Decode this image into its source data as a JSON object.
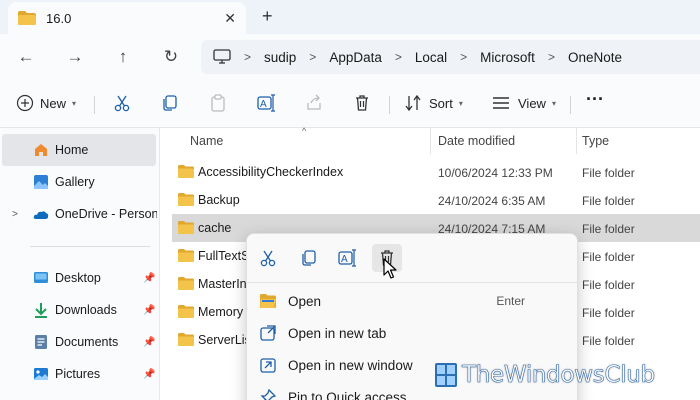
{
  "tab": {
    "title": "16.0",
    "close_glyph": "✕",
    "new_glyph": "+"
  },
  "nav": {
    "back": "←",
    "forward": "→",
    "up": "↑",
    "refresh": "↻"
  },
  "breadcrumb": [
    "sudip",
    "AppData",
    "Local",
    "Microsoft",
    "OneNote"
  ],
  "toolbar": {
    "new_label": "New",
    "sort_label": "Sort",
    "view_label": "View",
    "more_glyph": "···"
  },
  "sidebar": {
    "items": [
      {
        "label": "Home",
        "icon": "home-icon",
        "selected": true
      },
      {
        "label": "Gallery",
        "icon": "gallery-icon"
      },
      {
        "label": "OneDrive - Personal",
        "icon": "onedrive-icon",
        "expandable": true
      },
      {
        "label": "Desktop",
        "icon": "desktop-icon",
        "pinned": true
      },
      {
        "label": "Downloads",
        "icon": "downloads-icon",
        "pinned": true
      },
      {
        "label": "Documents",
        "icon": "documents-icon",
        "pinned": true
      },
      {
        "label": "Pictures",
        "icon": "pictures-icon",
        "pinned": true
      }
    ]
  },
  "columns": {
    "name": "Name",
    "date": "Date modified",
    "type": "Type"
  },
  "files": [
    {
      "name": "AccessibilityCheckerIndex",
      "date": "10/06/2024 12:33 PM",
      "type": "File folder"
    },
    {
      "name": "Backup",
      "date": "24/10/2024 6:35 AM",
      "type": "File folder"
    },
    {
      "name": "cache",
      "date": "24/10/2024 7:15 AM",
      "type": "File folder",
      "selected": true
    },
    {
      "name": "FullTextS",
      "date": "",
      "type": "File folder"
    },
    {
      "name": "MasterIn",
      "date": "",
      "type": "File folder"
    },
    {
      "name": "Memory",
      "date": "",
      "type": "File folder"
    },
    {
      "name": "ServerLis",
      "date": "",
      "type": "File folder"
    }
  ],
  "context_menu": {
    "tools": [
      "cut-icon",
      "copy-icon",
      "rename-icon",
      "delete-icon"
    ],
    "items": [
      {
        "label": "Open",
        "shortcut": "Enter",
        "icon": "folder-open-icon"
      },
      {
        "label": "Open in new tab",
        "shortcut": "",
        "icon": "new-tab-icon"
      },
      {
        "label": "Open in new window",
        "shortcut": "",
        "icon": "new-window-icon"
      },
      {
        "label": "Pin to Quick access",
        "shortcut": "",
        "icon": "pin-icon"
      }
    ]
  },
  "watermark": {
    "text": "TheWindowsClub"
  },
  "colors": {
    "folder": "#f4c34b",
    "folder_dark": "#e0a82e",
    "accent": "#0067c0",
    "selection": "#d9d9d9"
  }
}
